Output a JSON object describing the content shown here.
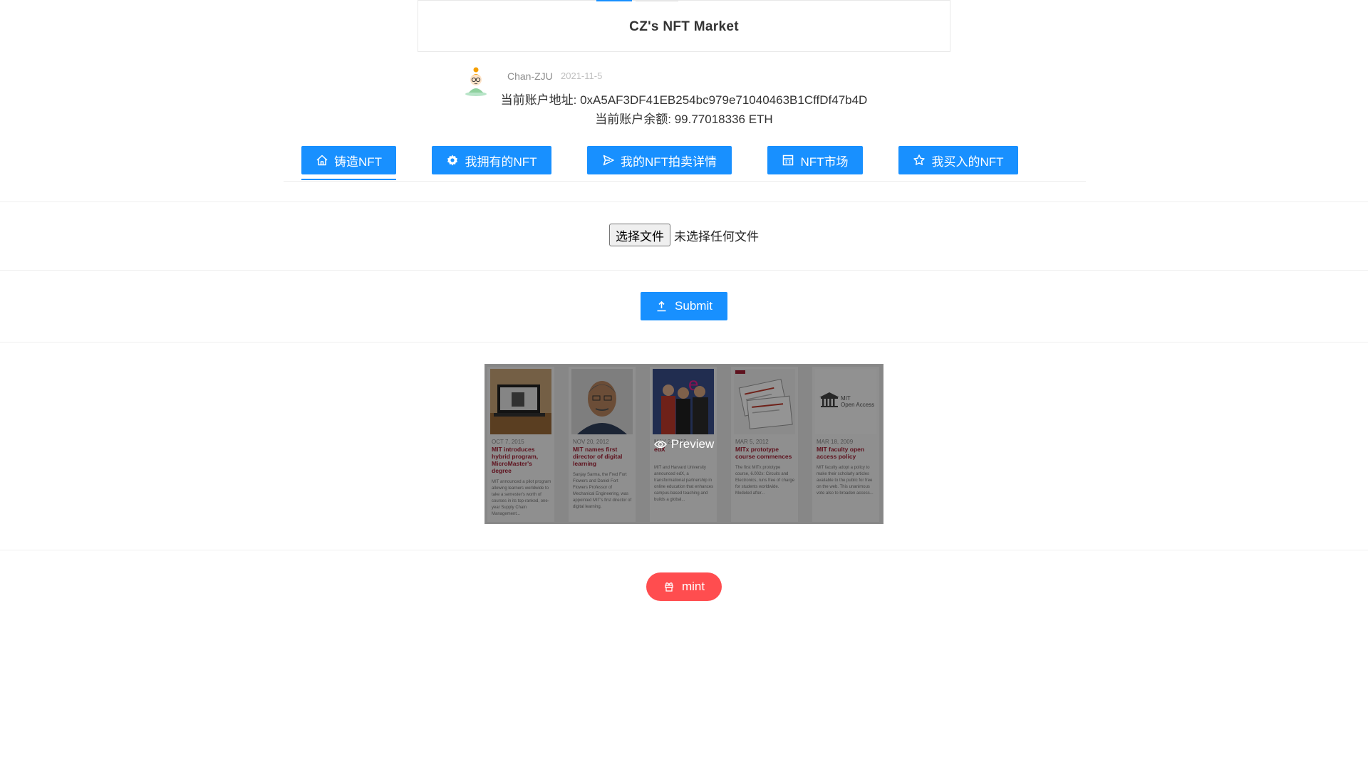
{
  "app": {
    "title": "CZ's NFT Market"
  },
  "profile": {
    "author": "Chan-ZJU",
    "date": "2021-11-5",
    "address_line": "当前账户地址: 0xA5AF3DF41EB254bc979e71040463B1CffDf47b4D",
    "balance_line": "当前账户余额: 99.77018336 ETH"
  },
  "menu": {
    "items": [
      {
        "label": "铸造NFT",
        "icon": "home-icon",
        "active": true
      },
      {
        "label": "我拥有的NFT",
        "icon": "gear-icon"
      },
      {
        "label": "我的NFT拍卖详情",
        "icon": "send-icon"
      },
      {
        "label": "NFT市场",
        "icon": "calculator-icon"
      },
      {
        "label": "我买入的NFT",
        "icon": "star-icon"
      }
    ]
  },
  "upload": {
    "choose_file_label": "选择文件",
    "file_status": "未选择任何文件",
    "submit_label": "Submit"
  },
  "preview": {
    "label": "Preview",
    "cards": [
      {
        "date": "OCT 7, 2015",
        "title": "MIT introduces hybrid program, MicroMaster's degree",
        "body": "MIT announced a pilot program allowing learners worldwide to take a semester's worth of courses in its top-ranked, one-year Supply Chain Management..."
      },
      {
        "date": "NOV 20, 2012",
        "title": "MIT names first director of digital learning",
        "body": "Sanjay Sarma, the Fred Fort Flowers and Daniel Fort Flowers Professor of Mechanical Engineering, was appointed MIT's first director of digital learning."
      },
      {
        "date": "MAY 2, 2012",
        "title": "edX",
        "body": "MIT and Harvard University announced edX, a transformational partnership in online education that enhances campus-based teaching and builds a global..."
      },
      {
        "date": "MAR 5, 2012",
        "title": "MITx prototype course commences",
        "body": "The first MITx prototype course, 6.002x: Circuits and Electronics, runs free of charge for students worldwide. Modeled after..."
      },
      {
        "date": "MAR 18, 2009",
        "title": "MIT faculty open access policy",
        "body": "MIT faculty adopt a policy to make their scholarly articles available to the public for free on the web. This unanimous vote also to broaden access..."
      }
    ],
    "logo_text_1": "MIT",
    "logo_text_2": "Open Access"
  },
  "mint": {
    "label": "mint"
  },
  "colors": {
    "primary": "#1890ff",
    "danger": "#ff4d4f",
    "mit_red": "#a31f34"
  }
}
